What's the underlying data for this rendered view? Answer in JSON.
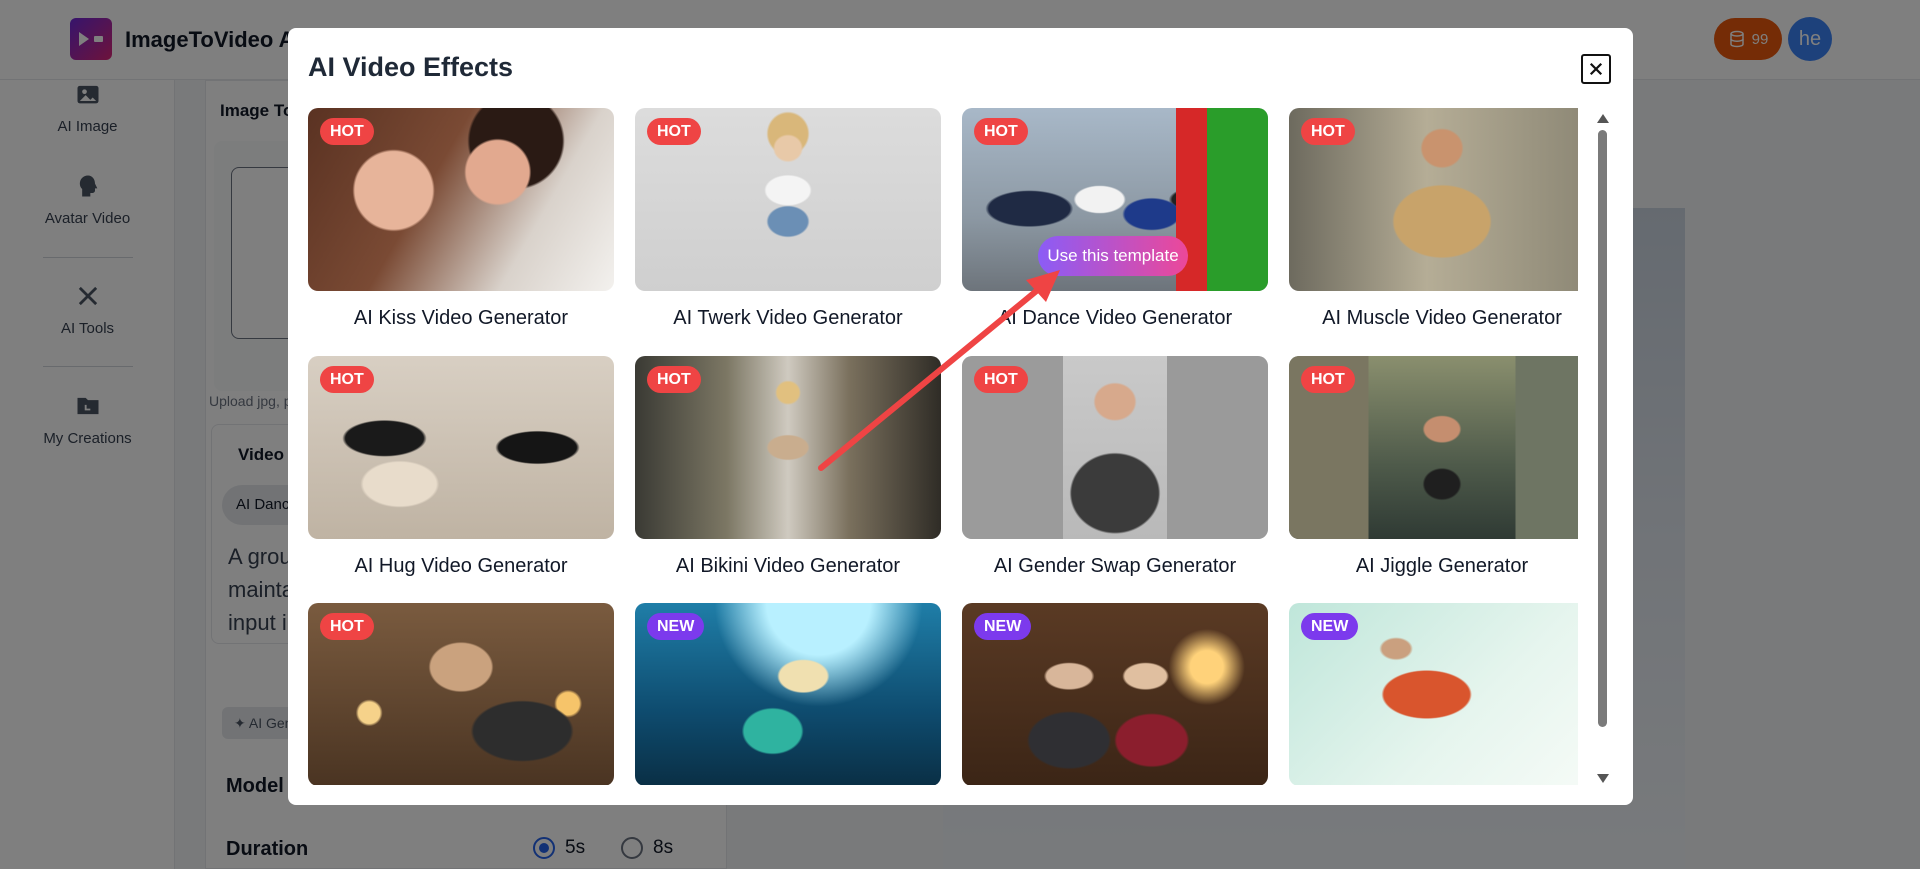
{
  "app": {
    "title": "ImageToVideo AI",
    "credits": "99",
    "user_initials": "he"
  },
  "sidebar": {
    "items": [
      {
        "label": "AI Image",
        "icon": "image-icon"
      },
      {
        "label": "Avatar Video",
        "icon": "avatar-head-icon"
      },
      {
        "label": "AI Tools",
        "icon": "tools-icon"
      },
      {
        "label": "My Creations",
        "icon": "folder-icon"
      }
    ]
  },
  "panel": {
    "title": "Image To Video",
    "upload_note": "Upload jpg, png",
    "effects_label": "Video Effects",
    "selected_effect": "AI Dance Video Generator",
    "prompt_text": [
      "A group",
      "maintai",
      "input im"
    ],
    "ai_button": "AI Generate",
    "model_label": "Model",
    "duration_label": "Duration",
    "duration_options": [
      {
        "label": "5s",
        "selected": true
      },
      {
        "label": "8s",
        "selected": false
      }
    ]
  },
  "modal": {
    "title": "AI Video Effects",
    "use_template_label": "Use this template",
    "cards": [
      {
        "label": "AI Kiss Video Generator",
        "badge": "HOT"
      },
      {
        "label": "AI Twerk Video Generator",
        "badge": "HOT"
      },
      {
        "label": "AI Dance Video Generator",
        "badge": "HOT"
      },
      {
        "label": "AI Muscle Video Generator",
        "badge": "HOT"
      },
      {
        "label": "AI Hug Video Generator",
        "badge": "HOT"
      },
      {
        "label": "AI Bikini Video Generator",
        "badge": "HOT"
      },
      {
        "label": "AI Gender Swap Generator",
        "badge": "HOT"
      },
      {
        "label": "AI Jiggle Generator",
        "badge": "HOT"
      },
      {
        "label": "",
        "badge": "HOT"
      },
      {
        "label": "",
        "badge": "NEW"
      },
      {
        "label": "",
        "badge": "NEW"
      },
      {
        "label": "",
        "badge": "NEW"
      }
    ]
  },
  "colors": {
    "hot_badge": "#ef4444",
    "new_badge": "#7c3aed",
    "credits_bg": "#ea580c",
    "avatar_bg": "#3b82f6",
    "annotation_arrow": "#ef4444"
  }
}
